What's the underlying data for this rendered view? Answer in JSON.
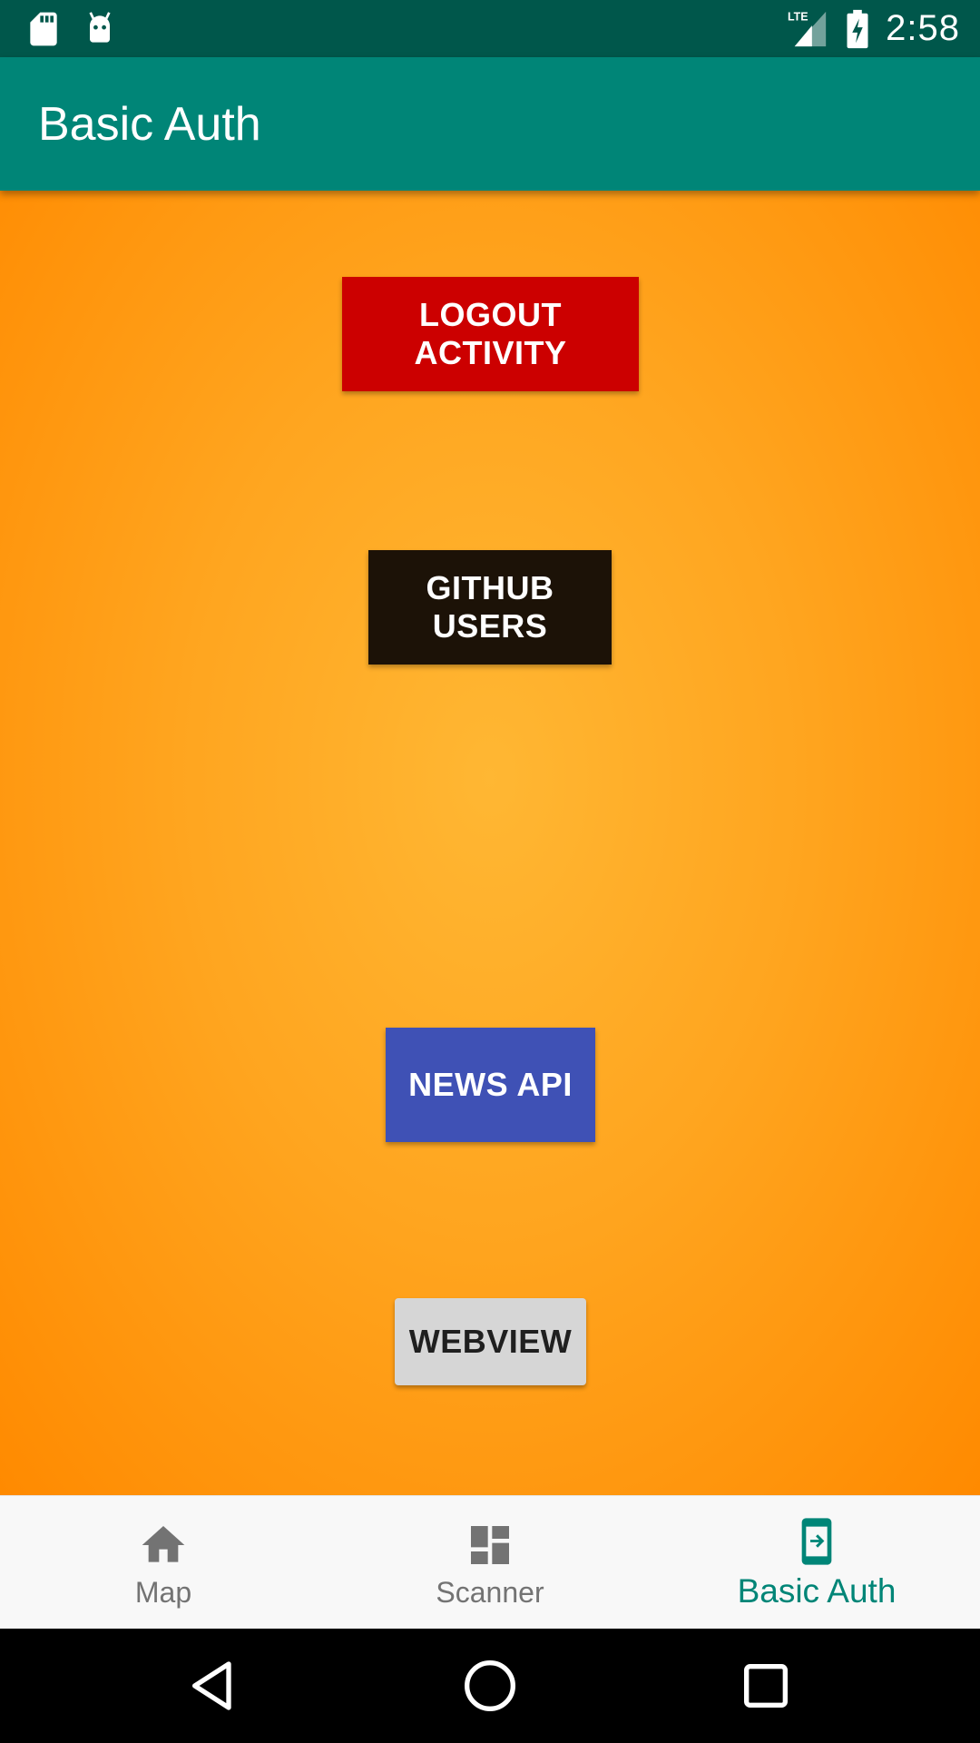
{
  "status_bar": {
    "time": "2:58",
    "network": "LTE",
    "icons": [
      "sd-card-icon",
      "android-icon",
      "lte-signal-icon",
      "battery-charging-icon"
    ]
  },
  "app_bar": {
    "title": "Basic Auth"
  },
  "content": {
    "buttons": [
      {
        "label": "LOGOUT ACTIVITY",
        "color": "#cc0000"
      },
      {
        "label": "GITHUB USERS",
        "color": "#1c1207"
      },
      {
        "label": "NEWS API",
        "color": "#3f51b5"
      },
      {
        "label": "WEBVIEW",
        "color": "#d6d6d6"
      }
    ]
  },
  "bottom_nav": {
    "items": [
      {
        "label": "Map",
        "icon": "home-icon",
        "active": false
      },
      {
        "label": "Scanner",
        "icon": "dashboard-icon",
        "active": false
      },
      {
        "label": "Basic Auth",
        "icon": "phone-login-icon",
        "active": true
      }
    ],
    "active_color": "#008577",
    "inactive_color": "#737373"
  },
  "system_nav": {
    "buttons": [
      "back-icon",
      "home-circle-icon",
      "recents-icon"
    ]
  },
  "colors": {
    "status_bar": "#00574b",
    "app_bar": "#008577",
    "background_center": "#ffb733",
    "background_edge": "#ff8a00"
  }
}
